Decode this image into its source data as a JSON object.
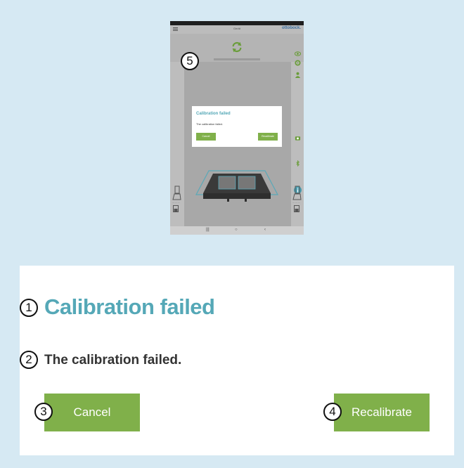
{
  "screenshot": {
    "device_name": "Gerät",
    "brand": "ottobock.",
    "dialog": {
      "title": "Calibration failed",
      "message": "The calibration failed.",
      "cancel_label": "Cancel",
      "recalibrate_label": "Recalibrate"
    },
    "navbar": {
      "recent": "|||",
      "home": "○",
      "back": "‹"
    },
    "callout": "5"
  },
  "dialog": {
    "title": "Calibration failed",
    "message": "The calibration failed.",
    "cancel_label": "Cancel",
    "recalibrate_label": "Recalibrate"
  },
  "callouts": {
    "title": "1",
    "message": "2",
    "cancel": "3",
    "recalibrate": "4"
  },
  "colors": {
    "background": "#d6e9f3",
    "accent_teal": "#55a8b7",
    "button_green": "#80b04a"
  }
}
